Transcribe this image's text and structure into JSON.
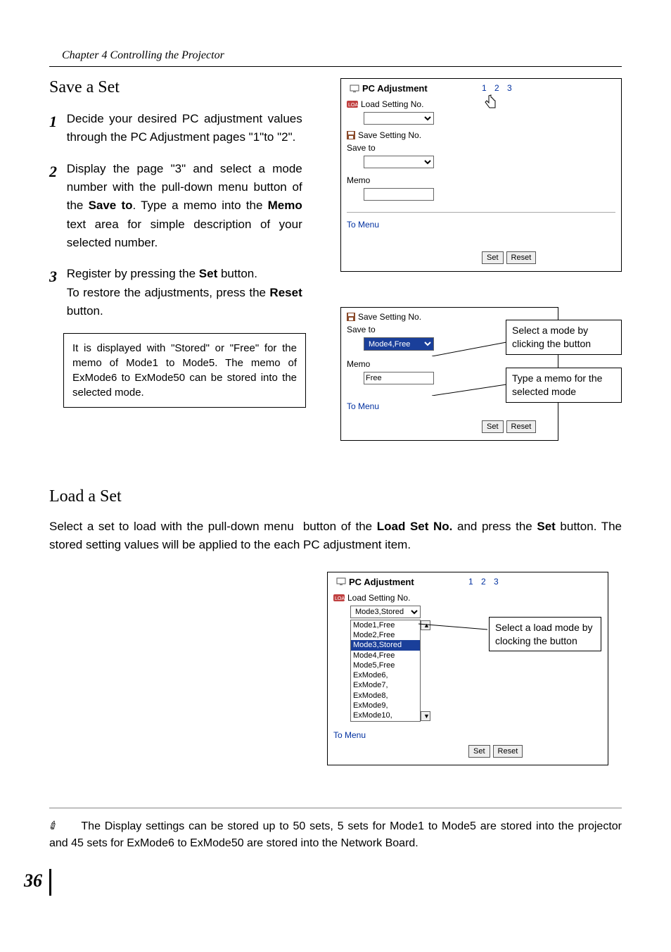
{
  "chapter_header": "Chapter 4 Controlling the Projector",
  "save_section": {
    "title": "Save a Set",
    "steps": [
      {
        "num": "1",
        "text": "Decide your desired PC adjustment values through the PC Adjustment pages \"1\"to \"2\"."
      },
      {
        "num": "2",
        "text": "Display the page \"3\" and select a mode number with the pull-down menu button of the Save to. Type a memo into the Memo text area for simple description of your selected number."
      },
      {
        "num": "3",
        "text_a": "Register by pressing the Set button.",
        "text_b": "To restore the adjustments, press the Reset button."
      }
    ],
    "note_box": "It is displayed with \"Stored\" or \"Free\" for the memo of Mode1 to Mode5. The memo of ExMode6 to ExMode50 can be stored into the selected mode."
  },
  "panel1": {
    "header_title": "PC Adjustment",
    "pages": "1 2 3",
    "load_label": "Load Setting No.",
    "save_label": "Save Setting No.",
    "save_to_label": "Save to",
    "memo_label": "Memo",
    "to_menu": "To Menu",
    "btn_set": "Set",
    "btn_reset": "Reset"
  },
  "panel2": {
    "save_label": "Save Setting No.",
    "save_to_label": "Save to",
    "save_to_value": "Mode4,Free",
    "memo_label": "Memo",
    "memo_value": "Free",
    "to_menu": "To Menu",
    "btn_set": "Set",
    "btn_reset": "Reset",
    "callout1": "Select a mode by clicking the button",
    "callout2": "Type a memo for the selected mode"
  },
  "load_section": {
    "title": "Load a Set",
    "text": "Select a set to load with the pull-down menu  button of the Load Set No. and press the Set button. The stored setting values will be applied to the each PC adjustment item."
  },
  "panel3": {
    "header_title": "PC Adjustment",
    "pages": "1 2 3",
    "load_label": "Load Setting No.",
    "selected": "Mode3,Stored",
    "options": [
      "Mode1,Free",
      "Mode2,Free",
      "Mode3,Stored",
      "Mode4,Free",
      "Mode5,Free",
      "ExMode6,",
      "ExMode7,",
      "ExMode8,",
      "ExMode9,",
      "ExMode10,"
    ],
    "to_menu": "To Menu",
    "btn_set": "Set",
    "btn_reset": "Reset",
    "callout": "Select a load mode by clocking the button"
  },
  "footer_note": "The Display settings can be stored up to 50 sets, 5 sets for Mode1 to Mode5 are stored into the projector and 45 sets for ExMode6 to ExMode50 are stored into the Network Board.",
  "page_number": "36"
}
